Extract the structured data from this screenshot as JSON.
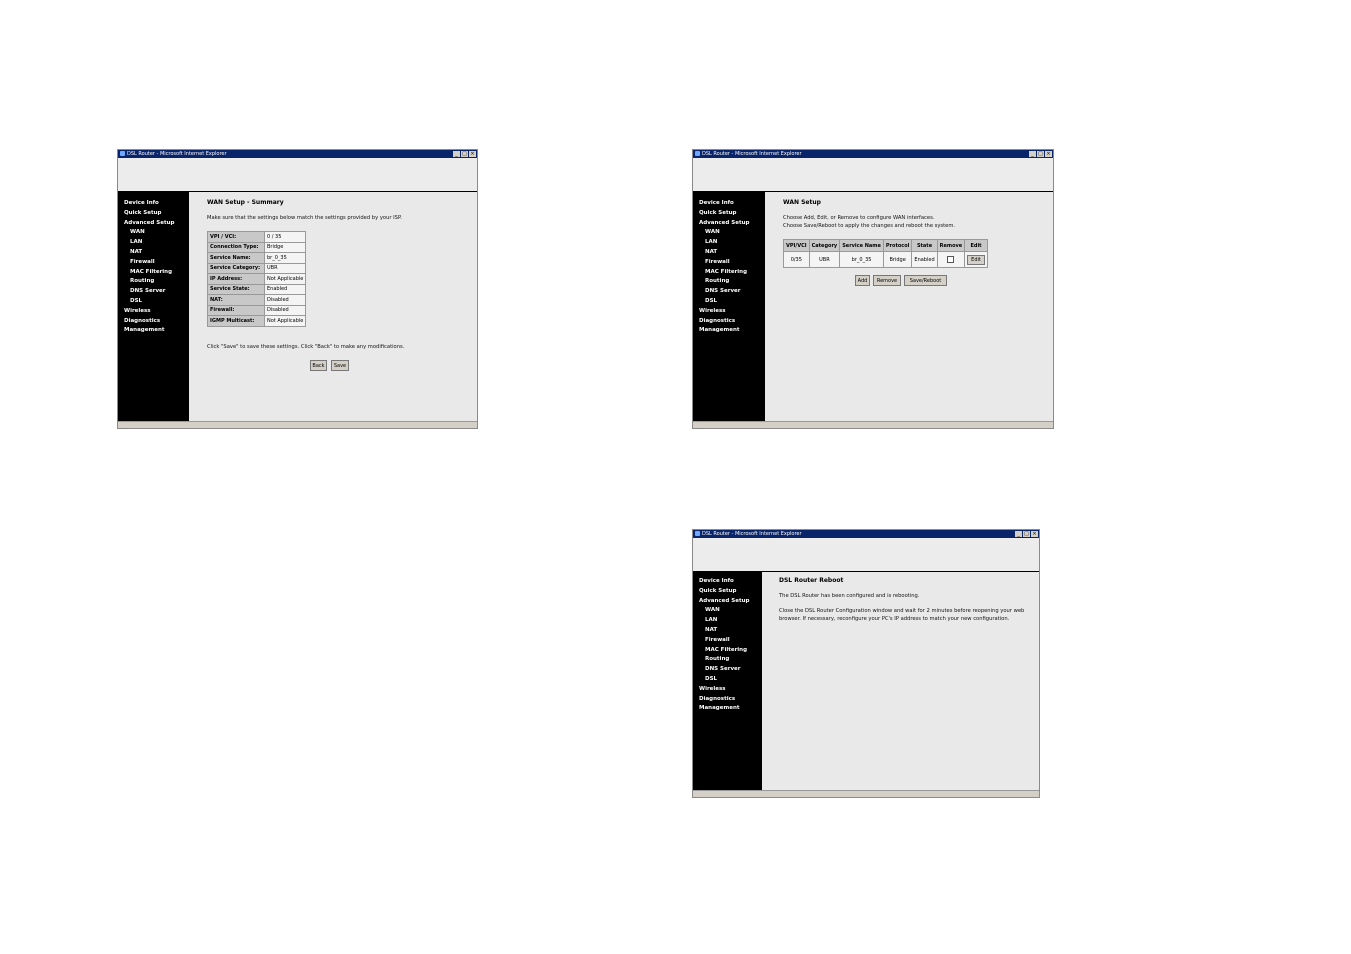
{
  "window_title": "DSL Router - Microsoft Internet Explorer",
  "window_controls": [
    "_",
    "□",
    "×"
  ],
  "sidebar": {
    "items": [
      {
        "label": "Device Info",
        "level": "top"
      },
      {
        "label": "Quick Setup",
        "level": "top"
      },
      {
        "label": "Advanced Setup",
        "level": "top"
      },
      {
        "label": "WAN",
        "level": "sub"
      },
      {
        "label": "LAN",
        "level": "sub"
      },
      {
        "label": "NAT",
        "level": "sub"
      },
      {
        "label": "Firewall",
        "level": "sub"
      },
      {
        "label": "MAC Filtering",
        "level": "sub"
      },
      {
        "label": "Routing",
        "level": "sub"
      },
      {
        "label": "DNS Server",
        "level": "sub"
      },
      {
        "label": "DSL",
        "level": "sub"
      },
      {
        "label": "Wireless",
        "level": "top"
      },
      {
        "label": "Diagnostics",
        "level": "top"
      },
      {
        "label": "Management",
        "level": "top"
      }
    ]
  },
  "summary": {
    "title": "WAN Setup - Summary",
    "intro": "Make sure that the settings below match the settings provided by your ISP.",
    "rows": [
      {
        "label": "VPI / VCI:",
        "value": "0 / 35"
      },
      {
        "label": "Connection Type:",
        "value": "Bridge"
      },
      {
        "label": "Service Name:",
        "value": "br_0_35"
      },
      {
        "label": "Service Category:",
        "value": "UBR"
      },
      {
        "label": "IP Address:",
        "value": "Not Applicable"
      },
      {
        "label": "Service State:",
        "value": "Enabled"
      },
      {
        "label": "NAT:",
        "value": "Disabled"
      },
      {
        "label": "Firewall:",
        "value": "Disabled"
      },
      {
        "label": "IGMP Multicast:",
        "value": "Not Applicable"
      }
    ],
    "hint": "Click \"Save\" to save these settings. Click \"Back\" to make any modifications.",
    "back_label": "Back",
    "save_label": "Save"
  },
  "wan_setup": {
    "title": "WAN Setup",
    "line1": "Choose Add, Edit, or Remove to configure WAN interfaces.",
    "line2": "Choose Save/Reboot to apply the changes and reboot the system.",
    "headers": [
      "VPI/VCI",
      "Category",
      "Service Name",
      "Protocol",
      "State",
      "Remove",
      "Edit"
    ],
    "row": {
      "vpivci": "0/35",
      "category": "UBR",
      "service_name": "br_0_35",
      "protocol": "Bridge",
      "state": "Enabled",
      "remove_checked": false,
      "edit_label": "Edit"
    },
    "add_label": "Add",
    "remove_label": "Remove",
    "save_reboot_label": "Save/Reboot"
  },
  "reboot": {
    "title": "DSL Router Reboot",
    "line1": "The DSL Router has been configured and is rebooting.",
    "line2": "Close the DSL Router Configuration window and wait for 2 minutes before reopening your web",
    "line3": "browser. If necessary, reconfigure your PC's IP address to match your new configuration."
  }
}
